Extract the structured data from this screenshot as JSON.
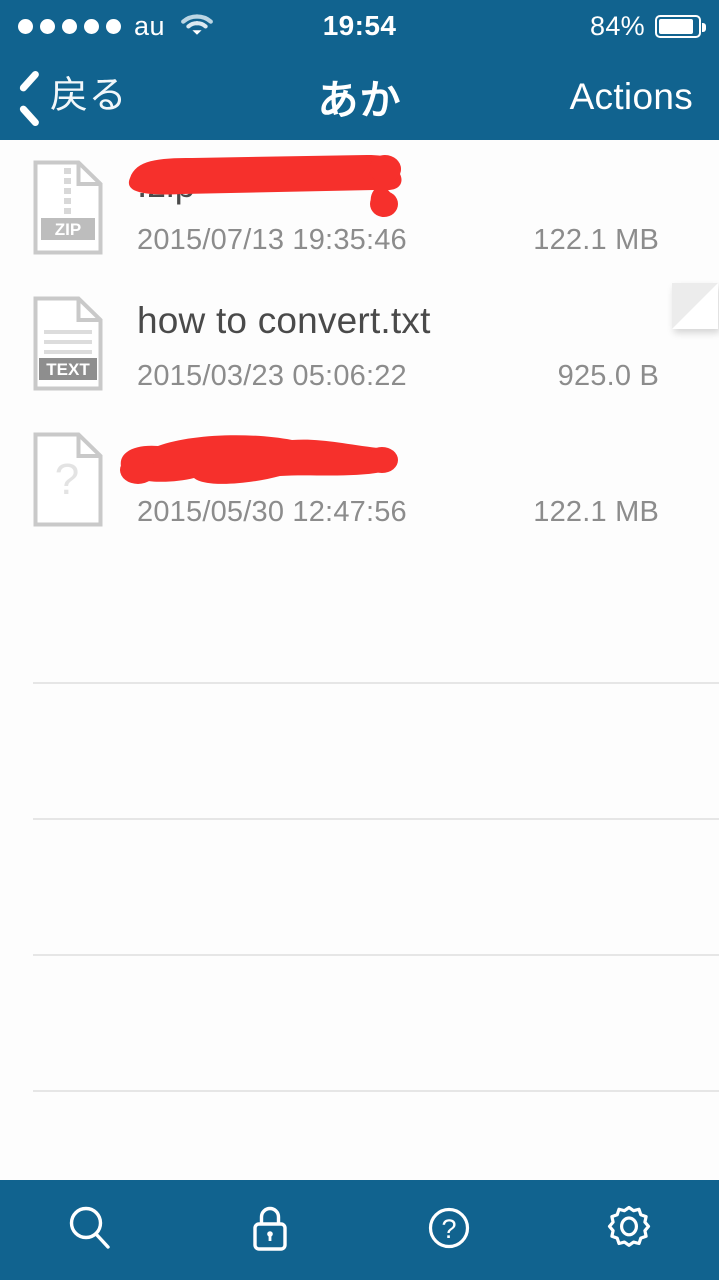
{
  "status_bar": {
    "signal_dots": 5,
    "carrier": "au",
    "wifi_icon": "wifi-icon",
    "time": "19:54",
    "battery_percent": "84%",
    "battery_level": 84
  },
  "nav_bar": {
    "back_icon": "chevron-left-icon",
    "back_label": "戻る",
    "title": "あか",
    "actions_label": "Actions"
  },
  "files": [
    {
      "icon": "zip-file-icon",
      "icon_badge": "ZIP",
      "name": ".zip",
      "redacted": true,
      "date": "2015/07/13 19:35:46",
      "size": "122.1 MB"
    },
    {
      "icon": "text-file-icon",
      "icon_badge": "TEXT",
      "name": "how to convert.txt",
      "redacted": false,
      "date": "2015/03/23 05:06:22",
      "size": "925.0 B"
    },
    {
      "icon": "unknown-file-icon",
      "icon_badge": "?",
      "name": "",
      "redacted": true,
      "date": "2015/05/30 12:47:56",
      "size": "122.1 MB"
    }
  ],
  "empty_rows": 5,
  "toolbar": {
    "items": [
      {
        "icon": "search-icon"
      },
      {
        "icon": "lock-icon"
      },
      {
        "icon": "help-icon"
      },
      {
        "icon": "gear-icon"
      }
    ]
  },
  "colors": {
    "chrome_blue": "#11638f",
    "redaction_red": "#f6302c",
    "text_primary": "#4a4a4a",
    "text_secondary": "#8c8c8c",
    "separator": "#e6e6e6"
  }
}
